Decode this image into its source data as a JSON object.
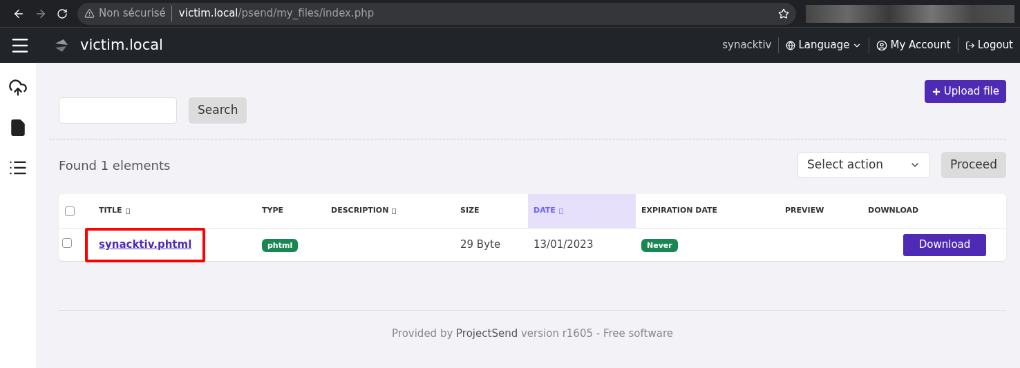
{
  "browser": {
    "security": "Non sécurisé",
    "url_host": "victim.local",
    "url_path": "/psend/my_files/index.php"
  },
  "navbar": {
    "brand": "victim.local",
    "user": "synacktiv",
    "language": "Language",
    "account": "My Account",
    "logout": "Logout"
  },
  "upload_button": "Upload file",
  "search": {
    "button": "Search"
  },
  "found": "Found 1 elements",
  "bulk": {
    "select": "Select action",
    "button": "Proceed"
  },
  "table": {
    "select_all_checked": false,
    "columns": [
      {
        "label": "TITLE",
        "sortable": true,
        "sorted": false
      },
      {
        "label": "TYPE",
        "sortable": false,
        "sorted": false
      },
      {
        "label": "DESCRIPTION",
        "sortable": true,
        "sorted": false
      },
      {
        "label": "SIZE",
        "sortable": false,
        "sorted": false
      },
      {
        "label": "DATE",
        "sortable": true,
        "sorted": true
      },
      {
        "label": "EXPIRATION DATE",
        "sortable": false,
        "sorted": false
      },
      {
        "label": "PREVIEW",
        "sortable": false,
        "sorted": false
      },
      {
        "label": "DOWNLOAD",
        "sortable": false,
        "sorted": false
      }
    ],
    "rows": [
      {
        "checked": false,
        "title": "synacktiv.phtml",
        "highlighted": true,
        "type": "phtml",
        "size": "29 Byte",
        "date": "13/01/2023",
        "expiration": "Never",
        "download": "Download"
      }
    ]
  },
  "footer": {
    "prefix": "Provided by ",
    "link": "ProjectSend",
    "suffix": " version r1605 - Free software"
  }
}
